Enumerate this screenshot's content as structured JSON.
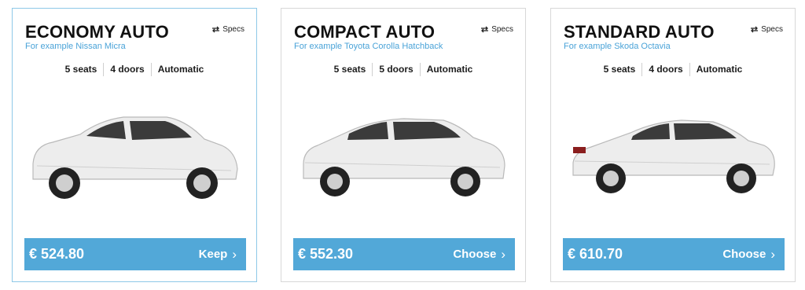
{
  "cards": [
    {
      "title": "ECONOMY AUTO",
      "example": "For example Nissan Micra",
      "specs_label": "Specs",
      "features": [
        "5 seats",
        "4 doors",
        "Automatic"
      ],
      "price": "€ 524.80",
      "action": "Keep",
      "selected": true
    },
    {
      "title": "COMPACT AUTO",
      "example": "For example Toyota Corolla Hatchback",
      "specs_label": "Specs",
      "features": [
        "5 seats",
        "5 doors",
        "Automatic"
      ],
      "price": "€ 552.30",
      "action": "Choose",
      "selected": false
    },
    {
      "title": "STANDARD AUTO",
      "example": "For example Skoda Octavia",
      "specs_label": "Specs",
      "features": [
        "5 seats",
        "4 doors",
        "Automatic"
      ],
      "price": "€ 610.70",
      "action": "Choose",
      "selected": false
    }
  ],
  "icons": {
    "specs": "swap-arrows-icon",
    "action": "chevron-right-icon",
    "car": "car-image"
  },
  "colors": {
    "accent": "#52a8d8",
    "example_text": "#4aa3d8",
    "selected_border": "#8ec9e8"
  }
}
